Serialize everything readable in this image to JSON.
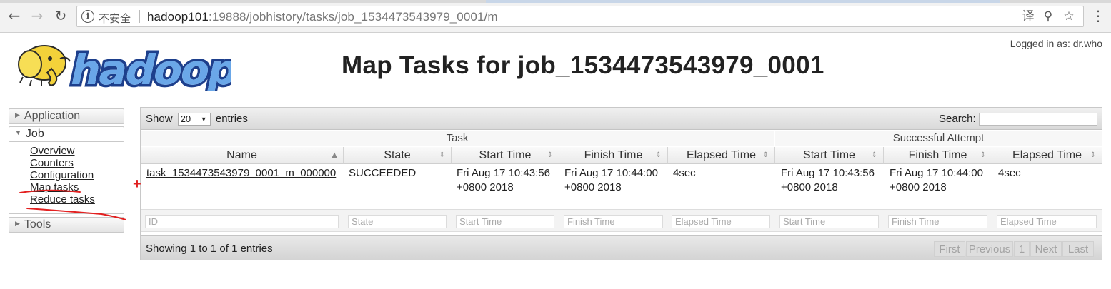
{
  "browser": {
    "security_label": "不安全",
    "url_host": "hadoop101",
    "url_rest": ":19888/jobhistory/tasks/job_1534473543979_0001/m"
  },
  "header": {
    "title": "Map Tasks for job_1534473543979_0001",
    "logged_in": "Logged in as: dr.who"
  },
  "sidebar": {
    "application": "Application",
    "job": "Job",
    "job_links": [
      "Overview",
      "Counters",
      "Configuration",
      "Map tasks",
      "Reduce tasks"
    ],
    "tools": "Tools"
  },
  "table": {
    "show_label": "Show",
    "entries_label": "entries",
    "page_length": "20",
    "search_label": "Search:",
    "groups": {
      "task": "Task",
      "attempt": "Successful Attempt"
    },
    "columns": [
      "Name",
      "State",
      "Start Time",
      "Finish Time",
      "Elapsed Time",
      "Start Time",
      "Finish Time",
      "Elapsed Time"
    ],
    "rows": [
      {
        "name": "task_1534473543979_0001_m_000000",
        "state": "SUCCEEDED",
        "start": "Fri Aug 17 10:43:56 +0800 2018",
        "finish": "Fri Aug 17 10:44:00 +0800 2018",
        "elapsed": "4sec",
        "att_start": "Fri Aug 17 10:43:56 +0800 2018",
        "att_finish": "Fri Aug 17 10:44:00 +0800 2018",
        "att_elapsed": "4sec"
      }
    ],
    "filters": [
      "ID",
      "State",
      "Start Time",
      "Finish Time",
      "Elapsed Time",
      "Start Time",
      "Finish Time",
      "Elapsed Time"
    ],
    "info": "Showing 1 to 1 of 1 entries",
    "pagination": [
      "First",
      "Previous",
      "1",
      "Next",
      "Last"
    ]
  }
}
